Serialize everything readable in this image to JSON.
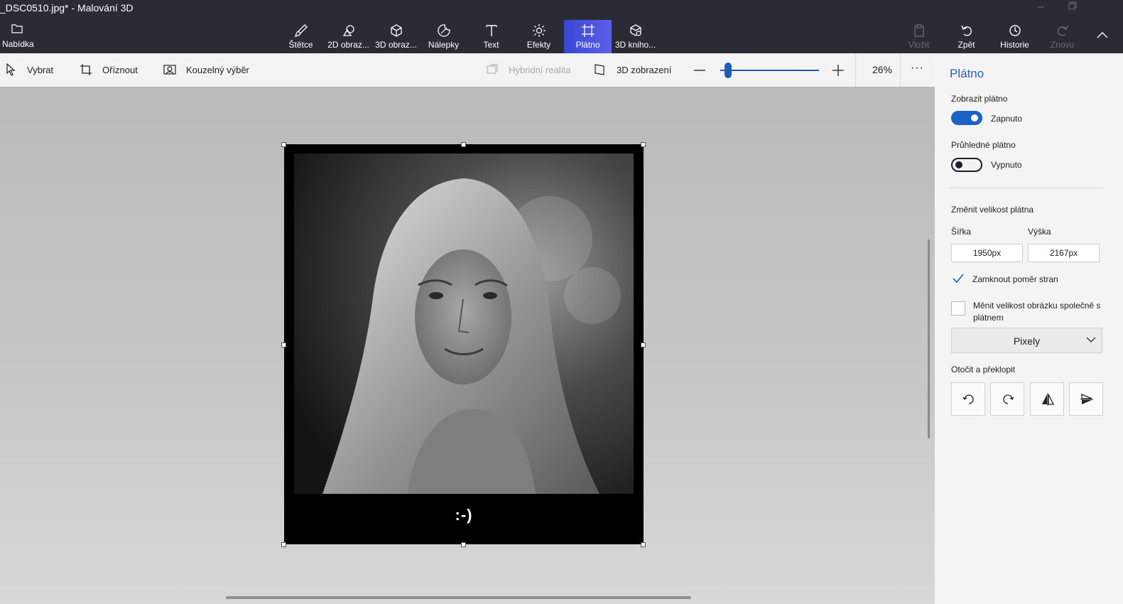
{
  "window": {
    "title": "_DSC0510.jpg* - Malování 3D"
  },
  "menu": {
    "label": "Nabídka",
    "icon": "folder-icon"
  },
  "ribbon": {
    "tools": [
      {
        "id": "brushes",
        "label": "Štětce",
        "icon": "brush-icon"
      },
      {
        "id": "shapes2d",
        "label": "2D obraz...",
        "icon": "shapes-2d-icon"
      },
      {
        "id": "shapes3d",
        "label": "3D obraz...",
        "icon": "cube-icon"
      },
      {
        "id": "stickers",
        "label": "Nálepky",
        "icon": "sticker-icon"
      },
      {
        "id": "text",
        "label": "Text",
        "icon": "text-icon"
      },
      {
        "id": "effects",
        "label": "Efekty",
        "icon": "sun-icon"
      },
      {
        "id": "canvas",
        "label": "Plátno",
        "icon": "canvas-icon"
      },
      {
        "id": "library3d",
        "label": "3D kniho...",
        "icon": "library-3d-icon"
      }
    ],
    "right": [
      {
        "id": "paste",
        "label": "Vložit",
        "disabled": true
      },
      {
        "id": "undo",
        "label": "Zpět",
        "disabled": false
      },
      {
        "id": "history",
        "label": "Historie",
        "disabled": false
      },
      {
        "id": "redo",
        "label": "Znovu",
        "disabled": true
      }
    ]
  },
  "toolbar": {
    "select": "Vybrat",
    "crop": "Oříznout",
    "magic_select": "Kouzelný výběr",
    "mixed_reality": "Hybridní realita",
    "view3d": "3D zobrazení",
    "zoom": {
      "value": 26,
      "min": 0,
      "max": 100,
      "label": "26%"
    },
    "more": "···"
  },
  "canvas": {
    "caption": ":-)"
  },
  "panel": {
    "title": "Plátno",
    "show_canvas": {
      "label": "Zobrazit plátno",
      "state": "Zapnuto",
      "on": true
    },
    "transparent_canvas": {
      "label": "Průhledné plátno",
      "state": "Vypnuto",
      "on": false
    },
    "resize_title": "Změnit velikost plátna",
    "width": {
      "label": "Šířka",
      "value": "1950px"
    },
    "height": {
      "label": "Výška",
      "value": "2167px"
    },
    "lock_ratio": {
      "label": "Zamknout poměr stran",
      "checked": true
    },
    "resize_image": {
      "label_line1": "Měnit velikost obrázku společně s",
      "label_line2": "plátnem",
      "checked": false
    },
    "units": {
      "value": "Pixely"
    },
    "rotate_title": "Otočit a překlopit"
  },
  "colors": {
    "accent": "#1a62c6",
    "ribbon_bg": "#2b2b36",
    "active_tool": "#3d4fd6"
  }
}
